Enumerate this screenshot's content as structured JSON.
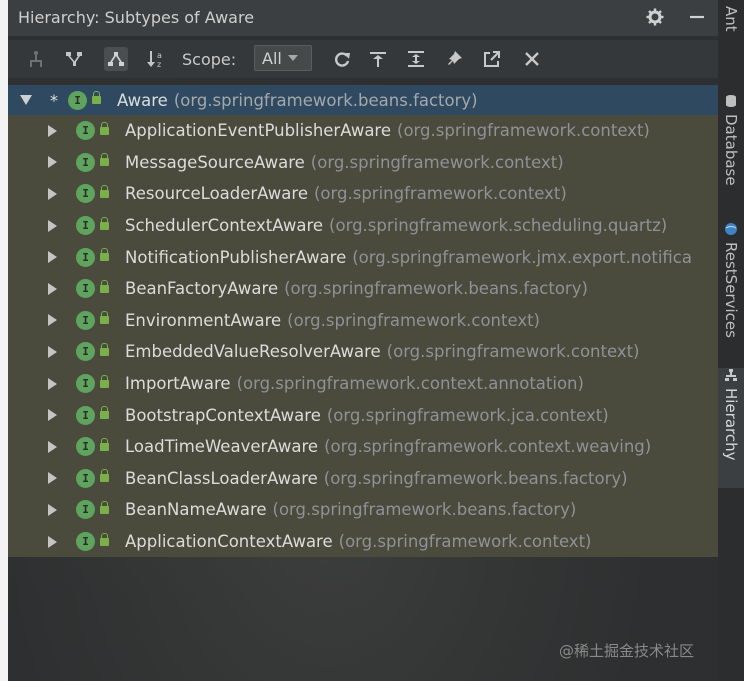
{
  "window": {
    "title": "Hierarchy: Subtypes of Aware"
  },
  "titlebar": {
    "settings_icon": "gear-icon",
    "minimize_icon": "minimize-icon"
  },
  "toolbar": {
    "scope_label": "Scope:",
    "scope_value": "All",
    "buttons": [
      "type-hierarchy-icon",
      "supertypes-icon",
      "subtypes-icon",
      "sort-alpha-icon",
      "refresh-icon",
      "expand-icon",
      "collapse-icon",
      "pin-icon",
      "export-icon",
      "close-icon"
    ]
  },
  "tree": {
    "root": {
      "marker": "*",
      "name": "Aware",
      "package": "(org.springframework.beans.factory)"
    },
    "children": [
      {
        "name": "ApplicationEventPublisherAware",
        "package": "(org.springframework.context)"
      },
      {
        "name": "MessageSourceAware",
        "package": "(org.springframework.context)"
      },
      {
        "name": "ResourceLoaderAware",
        "package": "(org.springframework.context)"
      },
      {
        "name": "SchedulerContextAware",
        "package": "(org.springframework.scheduling.quartz)"
      },
      {
        "name": "NotificationPublisherAware",
        "package": "(org.springframework.jmx.export.notifica"
      },
      {
        "name": "BeanFactoryAware",
        "package": "(org.springframework.beans.factory)"
      },
      {
        "name": "EnvironmentAware",
        "package": "(org.springframework.context)"
      },
      {
        "name": "EmbeddedValueResolverAware",
        "package": "(org.springframework.context)"
      },
      {
        "name": "ImportAware",
        "package": "(org.springframework.context.annotation)"
      },
      {
        "name": "BootstrapContextAware",
        "package": "(org.springframework.jca.context)"
      },
      {
        "name": "LoadTimeWeaverAware",
        "package": "(org.springframework.context.weaving)"
      },
      {
        "name": "BeanClassLoaderAware",
        "package": "(org.springframework.beans.factory)"
      },
      {
        "name": "BeanNameAware",
        "package": "(org.springframework.beans.factory)"
      },
      {
        "name": "ApplicationContextAware",
        "package": "(org.springframework.context)"
      }
    ]
  },
  "sidebar": {
    "tabs": [
      "Ant",
      "Database",
      "RestServices",
      "Hierarchy"
    ],
    "active": "Hierarchy"
  },
  "watermark": "@稀土掘金技术社区",
  "colors": {
    "root_highlight": "#2f4a60",
    "child_highlight": "#4a4a3d",
    "interface_icon": "#5ea35e"
  }
}
